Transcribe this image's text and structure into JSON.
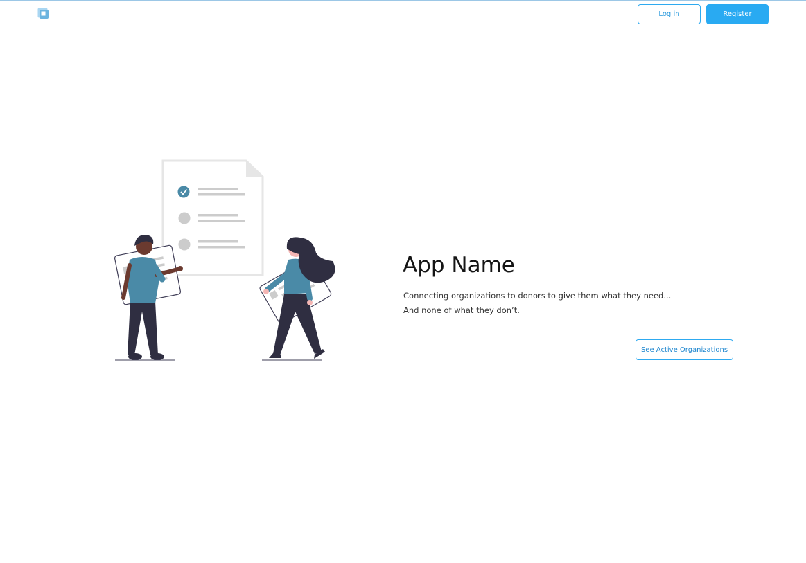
{
  "header": {
    "logo_icon": "app-logo-icon",
    "login_label": "Log in",
    "register_label": "Register"
  },
  "hero": {
    "title": "App Name",
    "tagline_line1": "Connecting organizations to donors to give them what they need...",
    "tagline_line2": "And none of what they don’t.",
    "cta_label": "See Active Organizations",
    "illustration": "checklist-illustration"
  },
  "colors": {
    "accent": "#29aaf2",
    "accent_dark": "#2196dc",
    "shirt": "#4a8aa7",
    "dark": "#2f2e41",
    "skin_dark": "#6b3a2f",
    "skin_light": "#f4b6b4",
    "doc_gray": "#e6e6e6",
    "line_gray": "#cccccc"
  }
}
